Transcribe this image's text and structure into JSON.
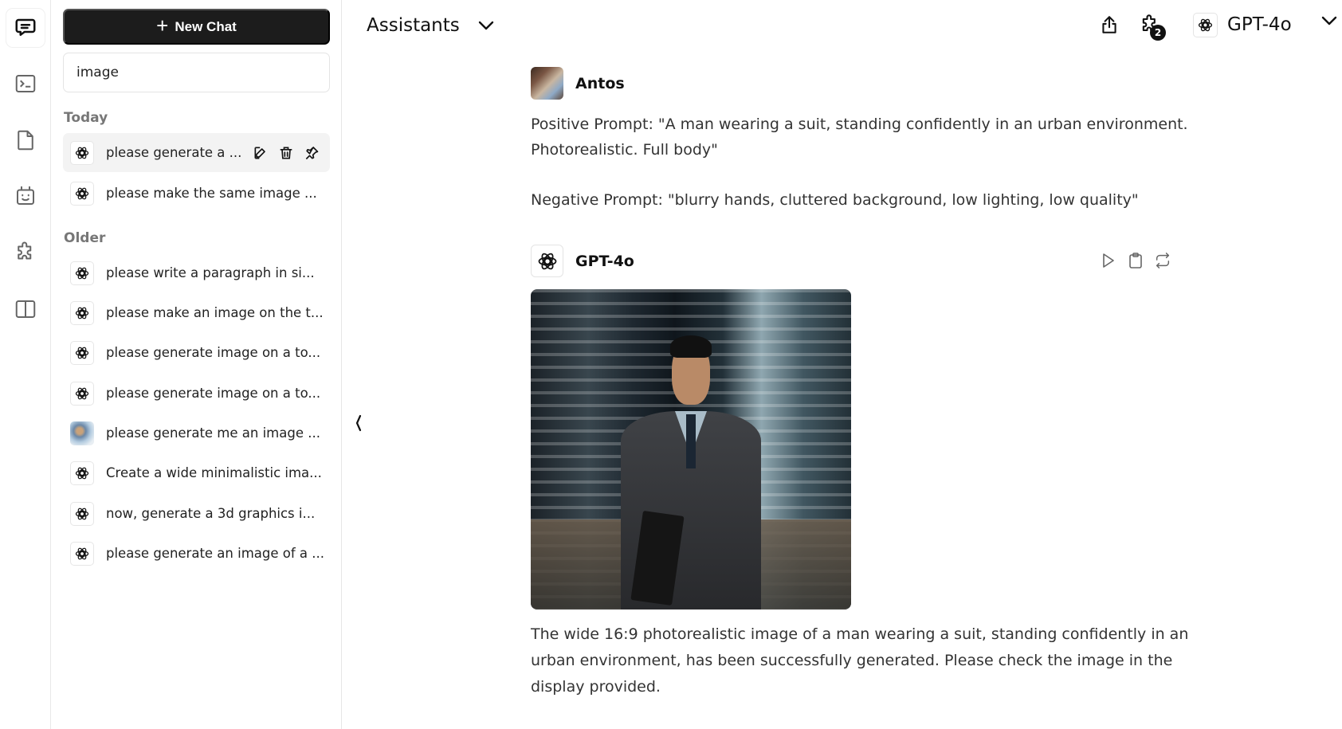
{
  "rail": {
    "items": [
      {
        "icon": "chat-icon",
        "label": "Chats",
        "active": true
      },
      {
        "icon": "terminal-icon",
        "label": "Prompts",
        "active": false
      },
      {
        "icon": "file-icon",
        "label": "Files",
        "active": false
      },
      {
        "icon": "bot-icon",
        "label": "Assistants",
        "active": false
      },
      {
        "icon": "puzzle-icon",
        "label": "Plugins",
        "active": false
      },
      {
        "icon": "panel-icon",
        "label": "Toggle panel",
        "active": false
      }
    ]
  },
  "sidebar": {
    "new_chat_label": "New Chat",
    "search_value": "image",
    "groups": [
      {
        "label": "Today",
        "items": [
          {
            "title": "please generate a ...",
            "icon": "openai-icon",
            "selected": true
          },
          {
            "title": "please make the same image ...",
            "icon": "openai-icon",
            "selected": false
          }
        ]
      },
      {
        "label": "Older",
        "items": [
          {
            "title": "please write a paragraph in si...",
            "icon": "openai-icon"
          },
          {
            "title": "please make an image on the t...",
            "icon": "openai-icon"
          },
          {
            "title": "please generate image on a to...",
            "icon": "openai-icon"
          },
          {
            "title": "please generate image on a to...",
            "icon": "openai-icon"
          },
          {
            "title": "please generate me an image ...",
            "icon": "custom-assistant-avatar"
          },
          {
            "title": "Create a wide minimalistic ima...",
            "icon": "openai-icon"
          },
          {
            "title": "now, generate a 3d graphics i...",
            "icon": "openai-icon"
          },
          {
            "title": "please generate an image of a ...",
            "icon": "openai-icon"
          }
        ]
      }
    ],
    "row_actions": [
      "edit",
      "delete",
      "pin"
    ]
  },
  "header": {
    "assistants_label": "Assistants",
    "plugins_badge": "2",
    "model_label": "GPT-4o"
  },
  "messages": [
    {
      "sender": "Antos",
      "role": "user",
      "paragraphs": [
        "Positive Prompt: \"A man wearing a suit, standing confidently in an urban environment. Photorealistic. Full body\"",
        "Negative Prompt: \"blurry hands, cluttered background, low lighting, low quality\""
      ]
    },
    {
      "sender": "GPT-4o",
      "role": "assistant",
      "image_alt": "Photorealistic man in a dark suit holding a briefcase in a night-time city street",
      "text": "The wide 16:9 photorealistic image of a man wearing a suit, standing confidently in an urban environment, has been successfully generated. Please check the image in the display provided.",
      "actions": [
        "play",
        "copy",
        "regenerate"
      ]
    }
  ],
  "colors": {
    "primary_button": "#1c1c1c",
    "selected_row": "#f3f3f3",
    "muted_label": "#777777",
    "border": "#e6e6e6"
  }
}
